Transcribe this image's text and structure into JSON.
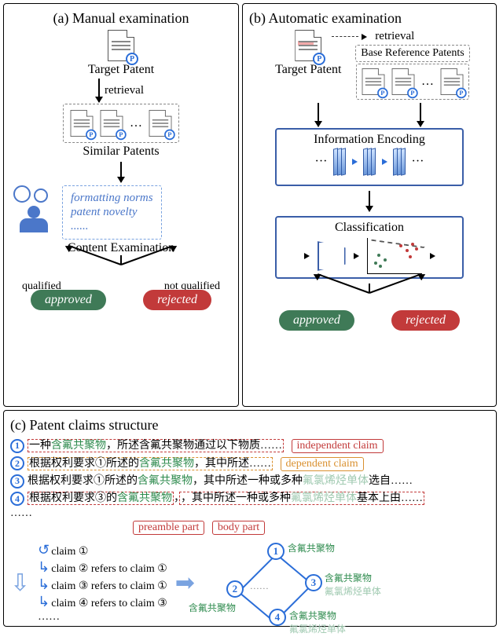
{
  "panel_a": {
    "title": "(a) Manual examination",
    "target_patent": "Target Patent",
    "retrieval": "retrieval",
    "similar_patents": "Similar Patents",
    "criteria": {
      "formatting": "formatting norms",
      "novelty": "patent novelty",
      "etc": "......"
    },
    "content_examination": "Content Examination",
    "qualified": "qualified",
    "not_qualified": "not qualified",
    "approved": "approved",
    "rejected": "rejected"
  },
  "panel_b": {
    "title": "(b) Automatic examination",
    "target_patent": "Target Patent",
    "retrieval": "retrieval",
    "base_reference": "Base Reference Patents",
    "info_encoding": "Information Encoding",
    "classification": "Classification",
    "approved": "approved",
    "rejected": "rejected"
  },
  "panel_c": {
    "title": "(c) Patent claims structure",
    "claims": [
      {
        "n": "1",
        "pre": "一种",
        "kw": "含氟共聚物",
        "rest": "，所述含氟共聚物通过以下物质……"
      },
      {
        "n": "2",
        "pre": "根据权利要求①",
        "mid": "所述的",
        "kw": "含氟共聚物",
        "rest": "，其中所述……"
      },
      {
        "n": "3",
        "pre": "根据权利要求①",
        "mid": "所述的",
        "kw": "含氟共聚物",
        "rest": "，其中所述一种或多种",
        "faint": "氟氯烯烃单体",
        "tail": "选自……"
      },
      {
        "n": "4",
        "pre": "根据权利要求③",
        "mid": "的",
        "kw": "含氟共聚物",
        "rest": "，其中所述一种或多种",
        "faint": "氟氯烯烃单体",
        "tail": "基本上由……"
      }
    ],
    "ellipsis": "……",
    "tag_independent": "independent claim",
    "tag_dependent": "dependent claim",
    "tag_preamble": "preamble part",
    "tag_body": "body part",
    "ref_list": [
      "claim ①",
      "claim ② refers to claim ①",
      "claim ③ refers to claim ①",
      "claim ④ refers to claim ③"
    ],
    "ref_ellipsis": "……",
    "node_labels": {
      "k": "含氟共聚物",
      "f": "氟氯烯烃单体"
    },
    "n1": "1",
    "n2": "2",
    "n3": "3",
    "n4": "4"
  }
}
